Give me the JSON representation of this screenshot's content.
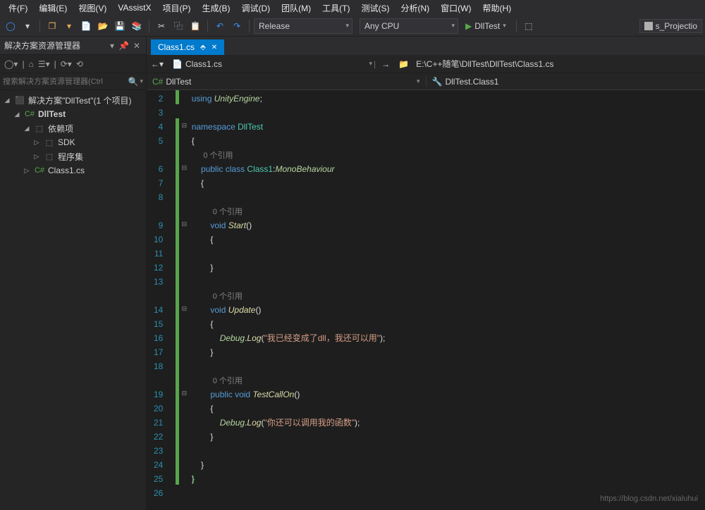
{
  "menu": [
    "件(F)",
    "编辑(E)",
    "视图(V)",
    "VAssistX",
    "项目(P)",
    "生成(B)",
    "调试(D)",
    "团队(M)",
    "工具(T)",
    "测试(S)",
    "分析(N)",
    "窗口(W)",
    "帮助(H)"
  ],
  "toolbar": {
    "config": "Release",
    "platform": "Any CPU",
    "run_target": "DllTest",
    "proj_selector": "s_Projectio"
  },
  "solution_explorer": {
    "title": "解决方案资源管理器",
    "search_placeholder": "搜索解决方案资源管理器(Ctrl",
    "solution_label": "解决方案\"DllTest\"(1 个项目)",
    "project": "DllTest",
    "deps": "依赖项",
    "sdk": "SDK",
    "assemblies": "程序集",
    "file": "Class1.cs"
  },
  "editor": {
    "tab": "Class1.cs",
    "nav_file": "Class1.cs",
    "nav_path": "E:\\C++随笔\\DllTest\\DllTest\\Class1.cs",
    "scope_left": "DllTest",
    "scope_right": "DllTest.Class1"
  },
  "code": {
    "lines": [
      2,
      3,
      4,
      5,
      6,
      7,
      8,
      9,
      10,
      11,
      12,
      13,
      14,
      15,
      16,
      17,
      18,
      19,
      20,
      21,
      22,
      23,
      24,
      25,
      26
    ],
    "using_kw": "using",
    "using_ns": "UnityEngine",
    "namespace_kw": "namespace",
    "namespace_name": "DllTest",
    "refs_label": "0 个引用",
    "public_kw": "public",
    "class_kw": "class",
    "class_name": "Class1",
    "base_class": "MonoBehaviour",
    "void_kw": "void",
    "start_fn": "Start",
    "update_fn": "Update",
    "testcall_fn": "TestCallOn",
    "debug_cls": "Debug",
    "log_fn": "Log",
    "log_msg1": "\"我已经变成了dll，我还可以用\"",
    "log_msg2": "\"你还可以调用我的函数\""
  },
  "watermark": "https://blog.csdn.net/xialuhui"
}
